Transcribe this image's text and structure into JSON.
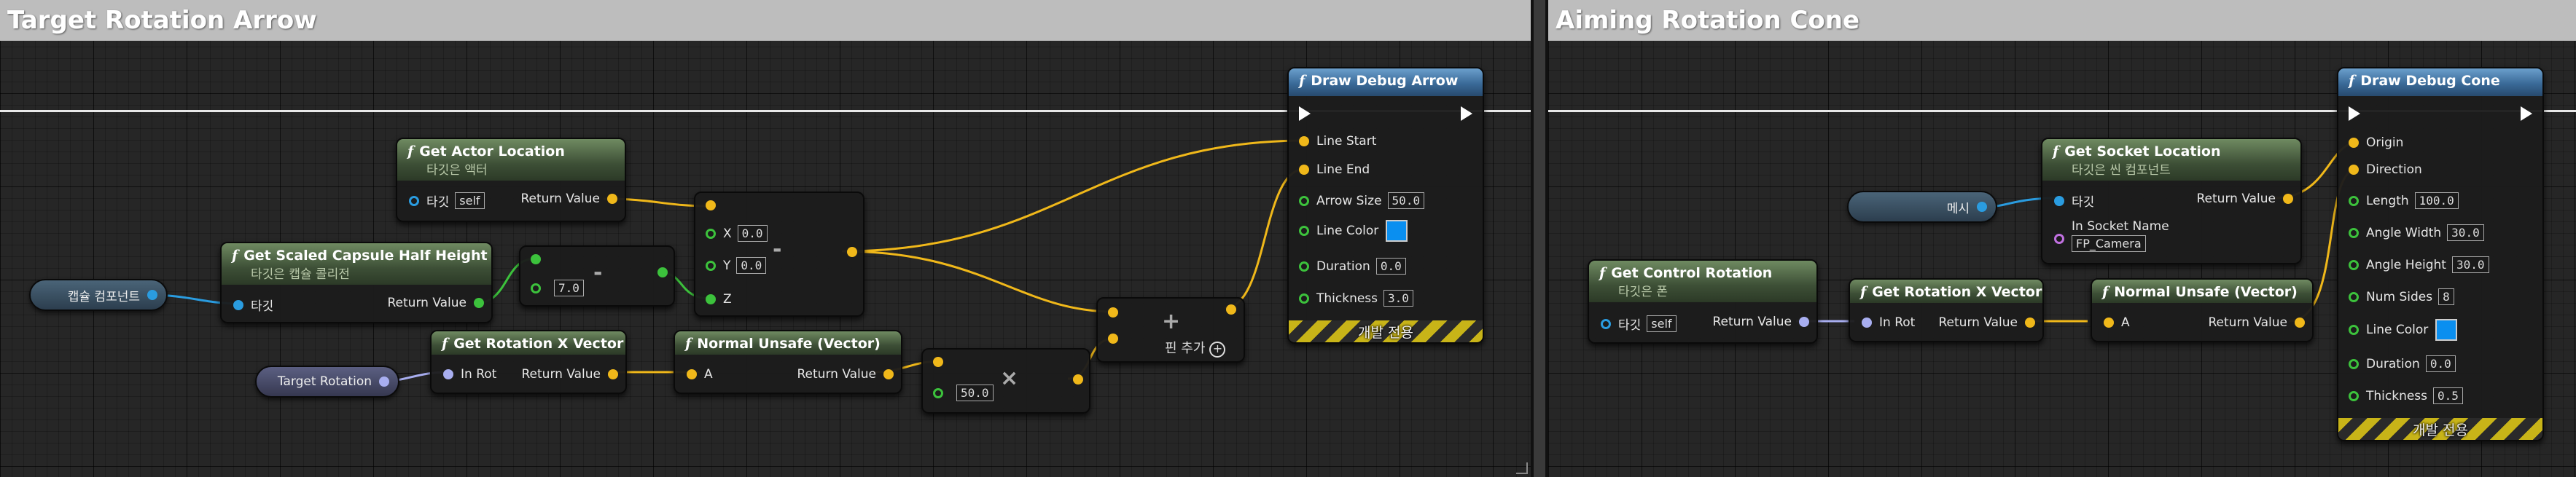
{
  "left_comment": {
    "title": "Target Rotation Arrow"
  },
  "right_comment": {
    "title": "Aiming Rotation Cone"
  },
  "icons": {
    "function": "f",
    "add": "+",
    "multiply": "×",
    "subtract": "-"
  },
  "nodes": {
    "get_actor_location": {
      "title": "Get Actor Location",
      "subtitle": "타깃은 액터",
      "target_label": "타깃",
      "target_value": "self",
      "return_label": "Return Value"
    },
    "get_scaled_capsule": {
      "title": "Get Scaled Capsule Half Height",
      "subtitle": "타깃은 캡슐 콜리전",
      "target_label": "타깃",
      "return_label": "Return Value"
    },
    "make_vector": {
      "x_label": "X",
      "x_value": "0.0",
      "y_label": "Y",
      "y_value": "0.0",
      "z_label": "Z"
    },
    "subtract": {
      "value": "7.0"
    },
    "get_rotation_x_vector_left": {
      "title": "Get Rotation X Vector",
      "in_label": "In Rot",
      "return_label": "Return Value"
    },
    "normal_unsafe_left": {
      "title": "Normal Unsafe (Vector)",
      "a_label": "A",
      "return_label": "Return Value"
    },
    "multiply": {
      "value": "50.0"
    },
    "add": {
      "add_pin_label": "핀 추가"
    },
    "draw_debug_arrow": {
      "title": "Draw Debug Arrow",
      "line_start": "Line Start",
      "line_end": "Line End",
      "arrow_size_label": "Arrow Size",
      "arrow_size": "50.0",
      "line_color_label": "Line Color",
      "duration_label": "Duration",
      "duration": "0.0",
      "thickness_label": "Thickness",
      "thickness": "3.0",
      "footer": "개발 전용"
    },
    "get_control_rotation": {
      "title": "Get Control Rotation",
      "subtitle": "타깃은 폰",
      "target_label": "타깃",
      "target_value": "self",
      "return_label": "Return Value"
    },
    "get_rotation_x_vector_right": {
      "title": "Get Rotation X Vector",
      "in_label": "In Rot",
      "return_label": "Return Value"
    },
    "get_socket_location": {
      "title": "Get Socket Location",
      "subtitle": "타깃은 씬 컴포넌트",
      "target_label": "타깃",
      "return_label": "Return Value",
      "socket_label": "In Socket Name",
      "socket_value": "FP_Camera"
    },
    "normal_unsafe_right": {
      "title": "Normal Unsafe (Vector)",
      "a_label": "A",
      "return_label": "Return Value"
    },
    "draw_debug_cone": {
      "title": "Draw Debug Cone",
      "origin": "Origin",
      "direction": "Direction",
      "length_label": "Length",
      "length": "100.0",
      "angle_width_label": "Angle Width",
      "angle_width": "30.0",
      "angle_height_label": "Angle Height",
      "angle_height": "30.0",
      "num_sides_label": "Num Sides",
      "num_sides": "8",
      "line_color_label": "Line Color",
      "duration_label": "Duration",
      "duration": "0.0",
      "thickness_label": "Thickness",
      "thickness": "0.5",
      "footer": "개발 전용"
    }
  },
  "variables": {
    "capsule_component": "캡슐 컴포넌트",
    "target_rotation": "Target Rotation",
    "mesh": "메시"
  },
  "colors": {
    "vector_pin": "#f0b81a",
    "float_pin": "#3cc23c",
    "object_pin": "#2a9ce0",
    "rotator_pin": "#a8aef0",
    "name_pin": "#c070e0",
    "line_color_swatch": "#0a8ff0"
  }
}
